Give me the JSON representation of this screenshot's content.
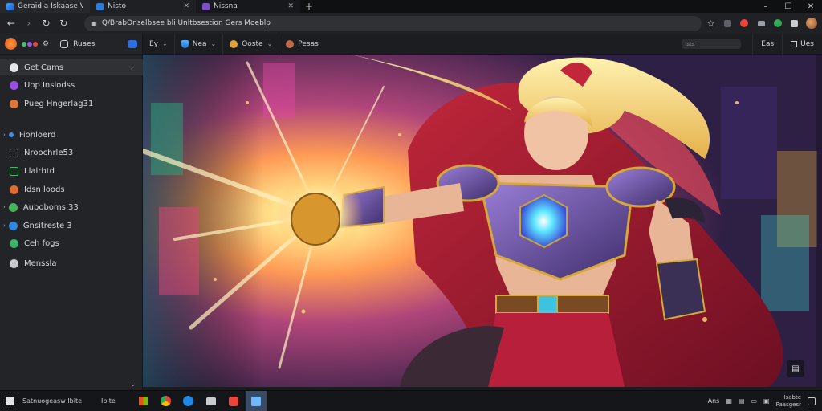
{
  "tabs": [
    {
      "label": "Geraid a Iskaase Vs",
      "icon": "shield-icon",
      "color": "#3aa3ff",
      "active": true
    },
    {
      "label": "Nisto",
      "icon": "page-icon",
      "color": "#2f7bd8"
    },
    {
      "label": "Nissna",
      "icon": "app-icon",
      "color": "#7a4fc4"
    }
  ],
  "new_tab_label": "+",
  "address": {
    "url": "Q/BrabOnselbsee bli Unltbsestion Gers Moeblp"
  },
  "toolbar": {
    "sidebar_label": "Ruaes",
    "groups": [
      {
        "label": "Ey",
        "icon": "sliders-icon"
      },
      {
        "label": "Nea",
        "icon": "shield-icon"
      },
      {
        "label": "Ooste",
        "icon": "gear-icon"
      },
      {
        "label": "Pesas",
        "icon": "face-icon"
      }
    ],
    "search_hint": "Ists",
    "btn1": "Eas",
    "btn2": "Ues"
  },
  "sidebar": {
    "items": [
      {
        "label": "Get Cams",
        "icon": "v-icon",
        "color": "#bfc1c4",
        "has_chevron": true,
        "highlight": true
      },
      {
        "label": "Uop Inslodss",
        "icon": "purple-orb-icon",
        "color": "#9a4fe0"
      },
      {
        "label": "Pueg Hngerlag31",
        "icon": "orange-gear-icon",
        "color": "#e0763a"
      },
      {
        "label": "Fionloerd",
        "icon": "blue-dot-icon",
        "color": "#3d8ee8",
        "bullet": true
      },
      {
        "label": "Nroochrle53",
        "icon": "square-outline-icon",
        "color": "#b6b8bb",
        "square": true
      },
      {
        "label": "Llalrbtd",
        "icon": "green-square-icon",
        "color": "#4bb46b",
        "square": true
      },
      {
        "label": "Idsn loods",
        "icon": "orange-circle-icon",
        "color": "#e06b2e"
      },
      {
        "label": "Auboboms 33",
        "icon": "green-circle-icon",
        "color": "#43b55a",
        "bullet": true
      },
      {
        "label": "Gnsitreste 3",
        "icon": "blue-globe-icon",
        "color": "#2e86de",
        "bullet": true
      },
      {
        "label": "Ceh fogs",
        "icon": "check-icon",
        "color": "#3fb36a"
      },
      {
        "label": "Menssla",
        "icon": "settings-icon",
        "color": "#c8c9cc"
      }
    ]
  },
  "taskbar": {
    "left_text": "Satnuogeasw Ibite",
    "left_text2": "Ibite",
    "tray_text": "Ans",
    "clock_time": "Isabte",
    "clock_date": "Paasgesr"
  },
  "colors": {
    "accent": "#8ab4f8",
    "chrome_bg": "#202124",
    "sidebar_bg": "#232427"
  }
}
